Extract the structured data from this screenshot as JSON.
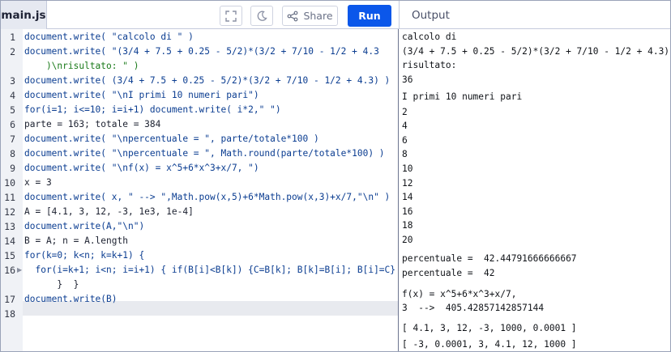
{
  "header": {
    "file_tab": "main.js",
    "share_label": "Share",
    "run_label": "Run",
    "output_title": "Output"
  },
  "editor": {
    "line_numbers": [
      "1",
      "2",
      "3",
      "4",
      "5",
      "6",
      "7",
      "8",
      "9",
      "10",
      "11",
      "12",
      "13",
      "14",
      "15",
      "16",
      "17",
      "18"
    ],
    "lines": [
      "document.write( \"calcolo di \" )",
      "document.write( \"(3/4 + 7.5 + 0.25 - 5/2)*(3/2 + 7/10 - 1/2 + 4.3",
      "    )\\nrisultato: \" )",
      "document.write( (3/4 + 7.5 + 0.25 - 5/2)*(3/2 + 7/10 - 1/2 + 4.3) )",
      "document.write( \"\\nI primi 10 numeri pari\")",
      "for(i=1; i<=10; i=i+1) document.write( i*2,\" \")",
      "parte = 163; totale = 384",
      "document.write( \"\\npercentuale = \", parte/totale*100 )",
      "document.write( \"\\npercentuale = \", Math.round(parte/totale*100) )",
      "document.write( \"\\nf(x) = x^5+6*x^3+x/7, \")",
      "x = 3",
      "document.write( x, \" --> \",Math.pow(x,5)+6*Math.pow(x,3)+x/7,\"\\n\" )",
      "A = [4.1, 3, 12, -3, 1e3, 1e-4]",
      "document.write(A,\"\\n\")",
      "B = A; n = A.length",
      "for(k=0; k<n; k=k+1) {",
      "  for(i=k+1; i<n; i=i+1) { if(B[i]<B[k]) {C=B[k]; B[k]=B[i]; B[i]=C}",
      "      }  }",
      "document.write(B)",
      ""
    ]
  },
  "output": {
    "lines": [
      "calcolo di",
      "(3/4 + 7.5 + 0.25 - 5/2)*(3/2 + 7/10 - 1/2 + 4.3)",
      "risultato:",
      "36",
      "I primi 10 numeri pari",
      "2",
      "4",
      "6",
      "8",
      "10",
      "12",
      "14",
      "16",
      "18",
      "20",
      "percentuale =  42.44791666666667",
      "percentuale =  42",
      "f(x) = x^5+6*x^3+x/7,",
      "3  -->  405.42857142857144",
      "[ 4.1, 3, 12, -3, 1000, 0.0001 ]",
      "[ -3, 0.0001, 3, 4.1, 12, 1000 ]"
    ]
  }
}
